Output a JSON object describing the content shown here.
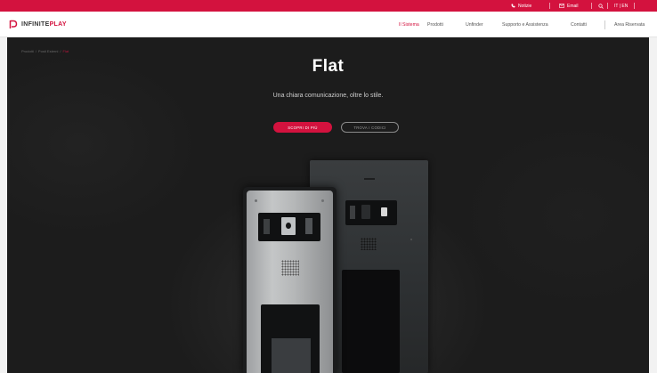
{
  "topbar": {
    "whatsapp_label": "Notizie",
    "email_label": "Email",
    "languages": "IT | EN"
  },
  "nav": {
    "logo_text_primary": "INFINITE",
    "logo_text_accent": "PLAY",
    "items": [
      {
        "label": "Il Sistema",
        "active": true
      },
      {
        "label": "Prodotti",
        "active": false
      },
      {
        "label": "Unfinder",
        "active": false
      },
      {
        "label": "Supporto e Assistenza",
        "active": false
      },
      {
        "label": "Contatti",
        "active": false
      },
      {
        "label": "Area Riservata",
        "active": false
      }
    ]
  },
  "hero": {
    "breadcrumb": [
      "Prodotti",
      "Posti Esterni",
      "Flat"
    ],
    "title": "Flat",
    "subtitle": "Una chiara comunicazione, oltre lo stile.",
    "primary_button": "Scopri di più",
    "secondary_button": "Trova i codici"
  },
  "colors": {
    "brand_red": "#d3123e",
    "hero_bg": "#1c1c1c",
    "nav_bg": "#ffffff"
  }
}
